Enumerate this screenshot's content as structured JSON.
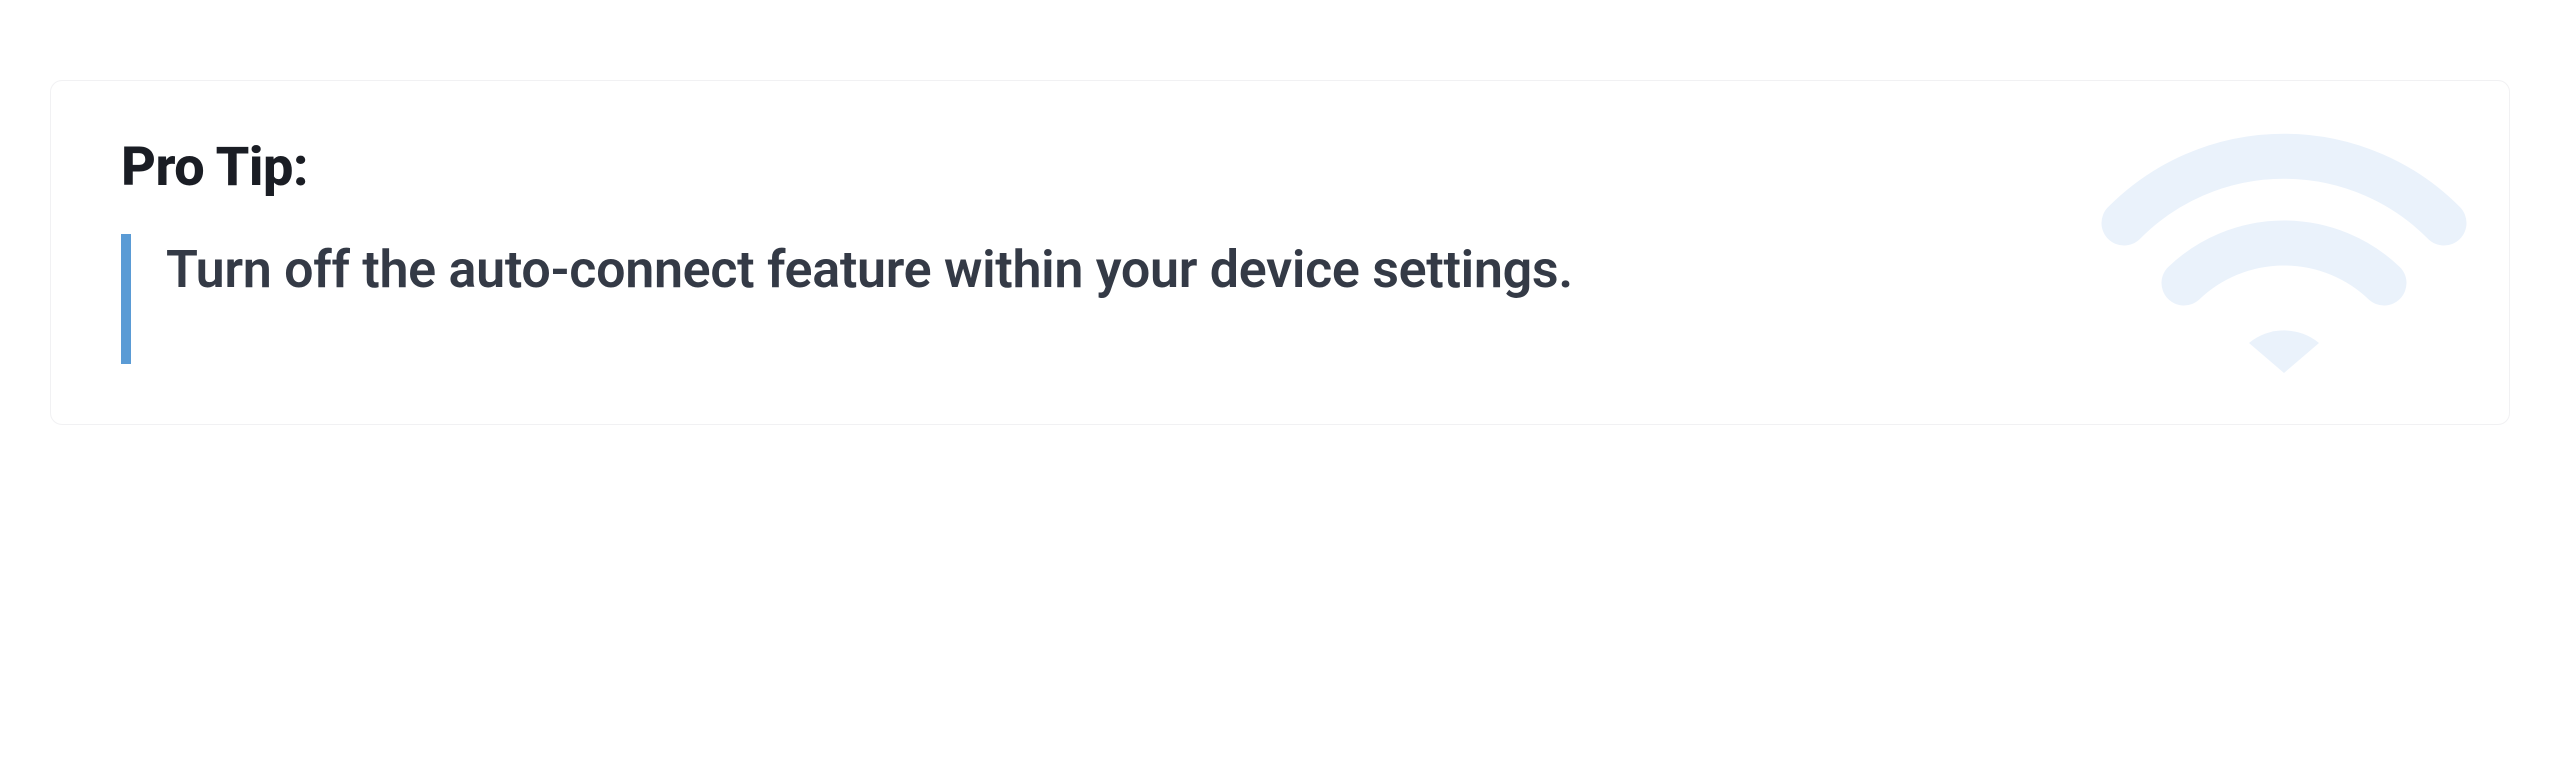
{
  "tip": {
    "title": "Pro Tip:",
    "body": "Turn off the auto-connect feature within your device settings."
  },
  "colors": {
    "accent": "#5a9bd5",
    "wifi_bg": "#eaf2fb",
    "title": "#1a1d24",
    "body": "#343a46"
  }
}
